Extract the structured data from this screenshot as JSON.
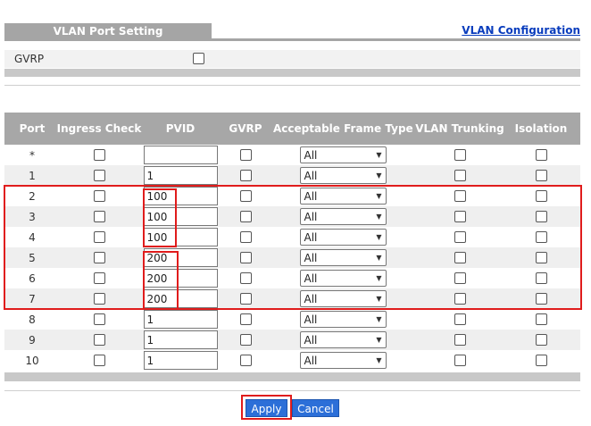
{
  "header": {
    "tab_label": "VLAN Port Setting",
    "link_label": "VLAN Configuration"
  },
  "gvrp_global": {
    "label": "GVRP",
    "checked": false
  },
  "table": {
    "columns": [
      "Port",
      "Ingress Check",
      "PVID",
      "GVRP",
      "Acceptable Frame Type",
      "VLAN Trunking",
      "Isolation"
    ],
    "rows": [
      {
        "port": "*",
        "pvid": "",
        "frame_type": "All"
      },
      {
        "port": "1",
        "pvid": "1",
        "frame_type": "All"
      },
      {
        "port": "2",
        "pvid": "100",
        "frame_type": "All"
      },
      {
        "port": "3",
        "pvid": "100",
        "frame_type": "All"
      },
      {
        "port": "4",
        "pvid": "100",
        "frame_type": "All"
      },
      {
        "port": "5",
        "pvid": "200",
        "frame_type": "All"
      },
      {
        "port": "6",
        "pvid": "200",
        "frame_type": "All"
      },
      {
        "port": "7",
        "pvid": "200",
        "frame_type": "All"
      },
      {
        "port": "8",
        "pvid": "1",
        "frame_type": "All"
      },
      {
        "port": "9",
        "pvid": "1",
        "frame_type": "All"
      },
      {
        "port": "10",
        "pvid": "1",
        "frame_type": "All"
      }
    ]
  },
  "buttons": {
    "apply": "Apply",
    "cancel": "Cancel"
  },
  "colors": {
    "header_gray": "#a7a7a7",
    "button_blue": "#2c6fd8",
    "highlight_red": "#e01c1c"
  }
}
